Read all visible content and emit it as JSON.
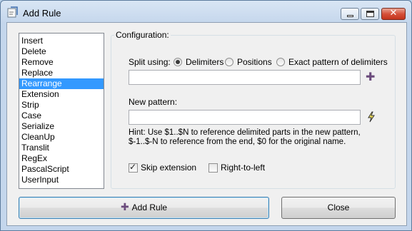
{
  "window": {
    "title": "Add Rule"
  },
  "rules": [
    "Insert",
    "Delete",
    "Remove",
    "Replace",
    "Rearrange",
    "Extension",
    "Strip",
    "Case",
    "Serialize",
    "CleanUp",
    "Translit",
    "RegEx",
    "PascalScript",
    "UserInput"
  ],
  "selected_rule": "Rearrange",
  "config": {
    "group_title": "Configuration:",
    "split_label": "Split using:",
    "split_options": [
      "Delimiters",
      "Positions",
      "Exact pattern of delimiters"
    ],
    "split_selected": "Delimiters",
    "delimiters_value": "",
    "new_pattern_label": "New pattern:",
    "new_pattern_value": "",
    "hint_line1": "Hint: Use $1..$N to reference delimited parts in the new pattern,",
    "hint_line2": "$-1..$-N to reference from the end, $0 for the original name.",
    "skip_extension_label": "Skip extension",
    "skip_extension_checked": true,
    "right_to_left_label": "Right-to-left",
    "right_to_left_checked": false
  },
  "buttons": {
    "add_rule": "Add Rule",
    "close": "Close"
  },
  "icons": {
    "add_delimiter": "plus-icon",
    "insert_meta": "lightning-icon",
    "app": "app-icon"
  }
}
